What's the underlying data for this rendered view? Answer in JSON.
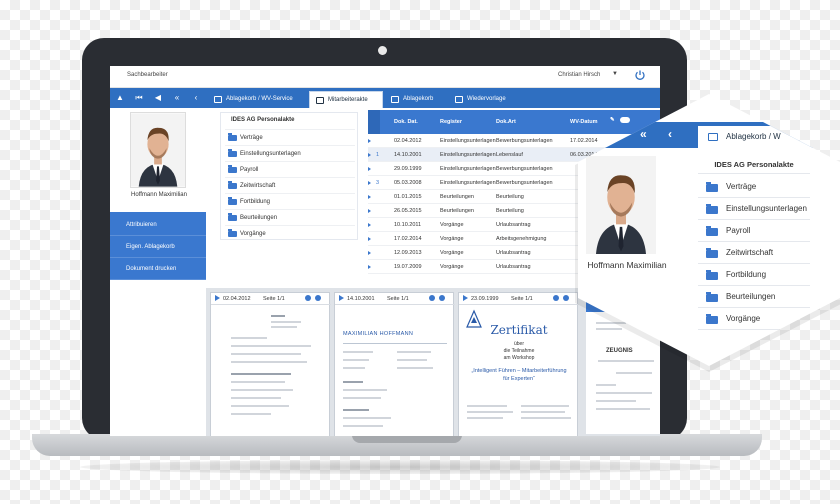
{
  "topbar": {
    "role_label": "Sachbearbeiter",
    "username": "Christian Hirsch"
  },
  "navbar": {
    "tabs": [
      {
        "label": "Ablagekorb / WV-Service"
      },
      {
        "label": "Mitarbeiterakte"
      },
      {
        "label": "Ablagekorb"
      },
      {
        "label": "Wiedervorlage"
      }
    ]
  },
  "profile": {
    "name": "Hoffmann Maximilian"
  },
  "sidebar": {
    "buttons": [
      {
        "label": "Attribuieren"
      },
      {
        "label": "Eigen. Ablagekorb"
      },
      {
        "label": "Dokument drucken"
      }
    ]
  },
  "tree": {
    "title": "IDES AG Personalakte",
    "items": [
      {
        "label": "Verträge"
      },
      {
        "label": "Einstellungsunterlagen"
      },
      {
        "label": "Payroll"
      },
      {
        "label": "Zeitwirtschaft"
      },
      {
        "label": "Fortbildung"
      },
      {
        "label": "Beurteilungen"
      },
      {
        "label": "Vorgänge"
      }
    ]
  },
  "table": {
    "headers": {
      "date": "Dok. Dat.",
      "register": "Register",
      "doctype": "Dok.Art",
      "wvdate": "WV-Datum"
    },
    "rows": [
      {
        "ind": "",
        "date": "02.04.2012",
        "register": "Einstellungsunterlagen",
        "doctype": "Bewerbungsunterlagen",
        "wv": "17.02.2014"
      },
      {
        "ind": "1",
        "date": "14.10.2001",
        "register": "Einstellungsunterlagen",
        "doctype": "Lebenslauf",
        "wv": "06.03.2014"
      },
      {
        "ind": "",
        "date": "29.09.1999",
        "register": "Einstellungsunterlagen",
        "doctype": "Bewerbungsunterlagen",
        "wv": ""
      },
      {
        "ind": "3",
        "date": "05.03.2008",
        "register": "Einstellungsunterlagen",
        "doctype": "Bewerbungsunterlagen",
        "wv": ""
      },
      {
        "ind": "",
        "date": "01.01.2015",
        "register": "Beurteilungen",
        "doctype": "Beurteilung",
        "wv": ""
      },
      {
        "ind": "",
        "date": "26.05.2015",
        "register": "Beurteilungen",
        "doctype": "Beurteilung",
        "wv": ""
      },
      {
        "ind": "",
        "date": "10.10.2011",
        "register": "Vorgänge",
        "doctype": "Urlaubsantrag",
        "wv": ""
      },
      {
        "ind": "",
        "date": "17.02.2014",
        "register": "Vorgänge",
        "doctype": "Arbeitsgenehmigung",
        "wv": ""
      },
      {
        "ind": "",
        "date": "12.09.2013",
        "register": "Vorgänge",
        "doctype": "Urlaubsantrag",
        "wv": ""
      },
      {
        "ind": "",
        "date": "19.07.2009",
        "register": "Vorgänge",
        "doctype": "Urlaubsantrag",
        "wv": ""
      }
    ]
  },
  "previews": [
    {
      "date": "02.04.2012",
      "page": "Seite 1/1"
    },
    {
      "date": "14.10.2001",
      "page": "Seite 1/1",
      "heading": "MAXIMILIAN HOFFMANN"
    },
    {
      "date": "23.09.1999",
      "page": "Seite 1/1",
      "title": "Zertifikat",
      "line1": "über",
      "line2": "die Teilnahme",
      "line3": "am Workshop",
      "quote": "„Intelligent Führen – Mitarbeiterführung für Experten“"
    }
  ],
  "behind": {
    "strip_label": "ieren",
    "zeugnis": "ZEUGNIS"
  },
  "callout": {
    "tab_label": "Ablagekorb / W",
    "name": "Hoffmann Maximilian",
    "title": "IDES AG Personalakte",
    "items": [
      {
        "label": "Verträge"
      },
      {
        "label": "Einstellungsunterlagen"
      },
      {
        "label": "Payroll"
      },
      {
        "label": "Zeitwirtschaft"
      },
      {
        "label": "Fortbildung"
      },
      {
        "label": "Beurteilungen"
      },
      {
        "label": "Vorgänge"
      }
    ]
  },
  "colors": {
    "brand_blue": "#2f6fc1",
    "panel_blue": "#3a78cf",
    "bezel": "#2a2d33"
  }
}
